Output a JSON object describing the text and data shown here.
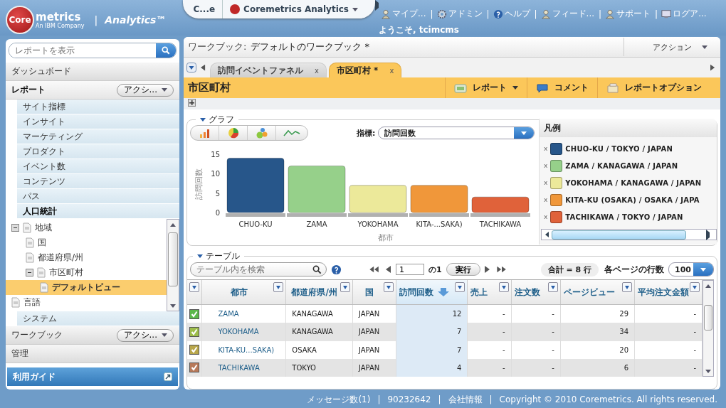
{
  "header": {
    "logo_mark": "Core",
    "logo_text": "metrics",
    "logo_sub": "An IBM Company",
    "separator": "|",
    "product": "Analytics™",
    "tabs": [
      {
        "label": "C...e",
        "selected": false
      },
      {
        "label": "Coremetrics Analytics",
        "selected": true
      }
    ],
    "links": [
      "マイプ...",
      "アドミン",
      "ヘルプ",
      "フィード...",
      "サポート",
      "ログア..."
    ],
    "welcome": "ようこそ, tcimcms"
  },
  "sidebar": {
    "search": {
      "placeholder": "レポートを表示"
    },
    "dashboard": "ダッシュボード",
    "reports": {
      "label": "レポート",
      "action": "アクシ...",
      "items": [
        {
          "label": "サイト指標",
          "selected": false
        },
        {
          "label": "インサイト",
          "selected": false
        },
        {
          "label": "マーケティング",
          "selected": false
        },
        {
          "label": "プロダクト",
          "selected": false
        },
        {
          "label": "イベント数",
          "selected": false
        },
        {
          "label": "コンテンツ",
          "selected": false
        },
        {
          "label": "パス",
          "selected": false
        },
        {
          "label": "人口統計",
          "selected": true,
          "children": [
            {
              "label": "地域",
              "expanded": true,
              "selected": false,
              "children": [
                {
                  "label": "国",
                  "selected": false
                },
                {
                  "label": "都道府県/州",
                  "selected": false
                },
                {
                  "label": "市区町村",
                  "expanded": true,
                  "selected": false,
                  "children": [
                    {
                      "label": "デフォルトビュー",
                      "selected": true
                    }
                  ]
                }
              ]
            },
            {
              "label": "言語",
              "selected": false
            }
          ]
        },
        {
          "label": "システム",
          "selected": false
        }
      ]
    },
    "workbook": {
      "label": "ワークブック",
      "action": "アクシ..."
    },
    "admin": "管理",
    "guide": "利用ガイド"
  },
  "workbook": {
    "label": "ワークブック:",
    "name": "デフォルトのワークブック *",
    "action": "アクション"
  },
  "tabs": [
    {
      "label": "訪問イベントファネル",
      "close": "x",
      "selected": false
    },
    {
      "label": "市区町村 *",
      "close": "x",
      "selected": true
    }
  ],
  "report": {
    "title": "市区町村",
    "buttons": [
      "レポート",
      "コメント",
      "レポートオプション"
    ]
  },
  "graph": {
    "title": "グラフ",
    "metric_label": "指標:",
    "metric": "訪問回数",
    "chart_data": {
      "type": "bar",
      "xlabel": "都市",
      "ylabel": "訪問回数",
      "categories": [
        "CHUO-KU",
        "ZAMA",
        "YOKOHAMA",
        "KITA-...SAKA)",
        "TACHIKAWA"
      ],
      "values": [
        14,
        12,
        7,
        7,
        4
      ],
      "ylim": [
        0,
        15
      ],
      "yticks": [
        0,
        5,
        10,
        15
      ]
    },
    "legend": {
      "title": "凡例",
      "items": [
        {
          "remove": "x",
          "label": "CHUO-KU / TOKYO / JAPAN",
          "color": "#27568a"
        },
        {
          "remove": "x",
          "label": "ZAMA / KANAGAWA / JAPAN",
          "color": "#96d08a"
        },
        {
          "remove": "x",
          "label": "YOKOHAMA / KANAGAWA / JAPAN",
          "color": "#ece99a"
        },
        {
          "remove": "x",
          "label": "KITA-KU (OSAKA) / OSAKA / JAPA",
          "color": "#f0973a"
        },
        {
          "remove": "x",
          "label": "TACHIKAWA / TOKYO / JAPAN",
          "color": "#e0623a"
        }
      ]
    }
  },
  "table": {
    "title": "テーブル",
    "search_placeholder": "テーブル内を検索",
    "page": "1",
    "of": "の1",
    "go": "実行",
    "total": "合計 = 8 行",
    "per_page_label": "各ページの行数",
    "per_page": "100",
    "columns": [
      {
        "label": "都市",
        "sorted": false,
        "kind": "text"
      },
      {
        "label": "都道府県/州",
        "sorted": false,
        "kind": "text"
      },
      {
        "label": "国",
        "sorted": false,
        "kind": "text"
      },
      {
        "label": "訪問回数",
        "sorted": true,
        "kind": "number"
      },
      {
        "label": "売上",
        "sorted": false,
        "kind": "number"
      },
      {
        "label": "注文数",
        "sorted": false,
        "kind": "number"
      },
      {
        "label": "ページビュー",
        "sorted": false,
        "kind": "number"
      },
      {
        "label": "平均注文金額",
        "sorted": false,
        "kind": "number"
      }
    ],
    "rows": [
      {
        "checked": true,
        "color": "#5cb84a",
        "cells": [
          "ZAMA",
          "KANAGAWA",
          "JAPAN",
          "12",
          "-",
          "-",
          "29",
          "-"
        ]
      },
      {
        "checked": true,
        "color": "#9dbd4a",
        "cells": [
          "YOKOHAMA",
          "KANAGAWA",
          "JAPAN",
          "7",
          "-",
          "-",
          "34",
          "-"
        ]
      },
      {
        "checked": true,
        "color": "#b8a64a",
        "cells": [
          "KITA-KU...SAKA)",
          "OSAKA",
          "JAPAN",
          "7",
          "-",
          "-",
          "20",
          "-"
        ]
      },
      {
        "checked": true,
        "color": "#b87a5a",
        "cells": [
          "TACHIKAWA",
          "TOKYO",
          "JAPAN",
          "4",
          "-",
          "-",
          "6",
          "-"
        ]
      }
    ]
  },
  "footer": {
    "separator": "|",
    "items": [
      "メッセージ数(1)",
      "90232642",
      "会社情報",
      "Copyright © 2010 Coremetrics. All rights reserved."
    ]
  }
}
